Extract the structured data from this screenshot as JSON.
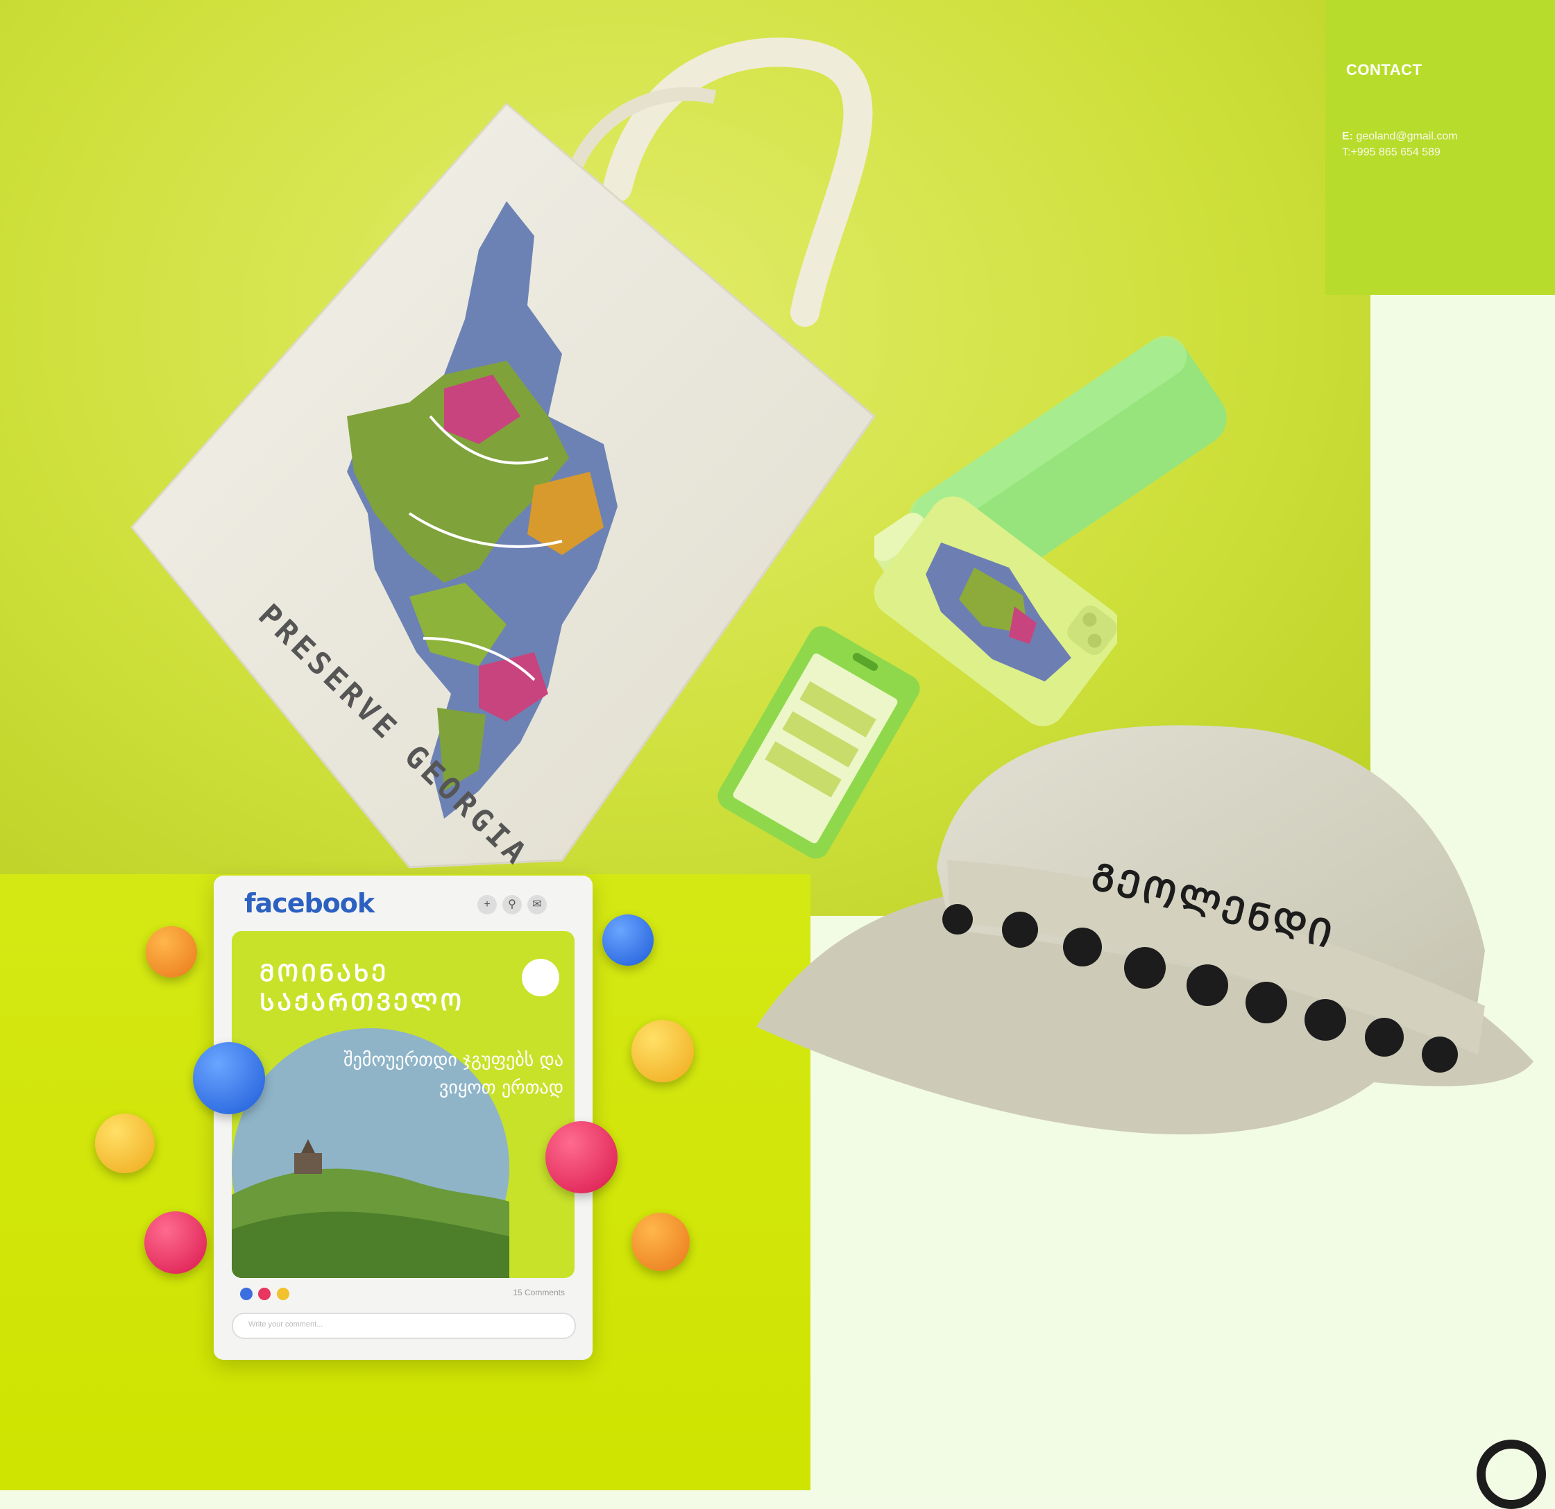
{
  "contact": {
    "title": "CONTACT",
    "email_label": "E:",
    "email": "geoland@gmail.com",
    "phone": "T:+995 865 654 589"
  },
  "tote": {
    "print_text": "PRESERVE GEORGIA"
  },
  "hat": {
    "logo_text": "ᲒᲔᲝᲚᲔᲜᲓᲘ"
  },
  "facebook_post": {
    "app_name": "facebook",
    "headline_line1": "ᲛᲝᲘᲜᲐᲮᲔ",
    "headline_line2": "ᲡᲐᲥᲐᲠᲗᲕᲔᲚᲝ",
    "description": "შემოუერთდი ჯგუფებს და ვიყოთ ერთად",
    "comments": "15 Comments",
    "comment_placeholder": "Write your comment..."
  },
  "colors": {
    "accent_lime": "#cfe400",
    "panel_green": "#b8dc2b",
    "cream": "#f2fbe4",
    "facebook_blue": "#2c61c2"
  }
}
